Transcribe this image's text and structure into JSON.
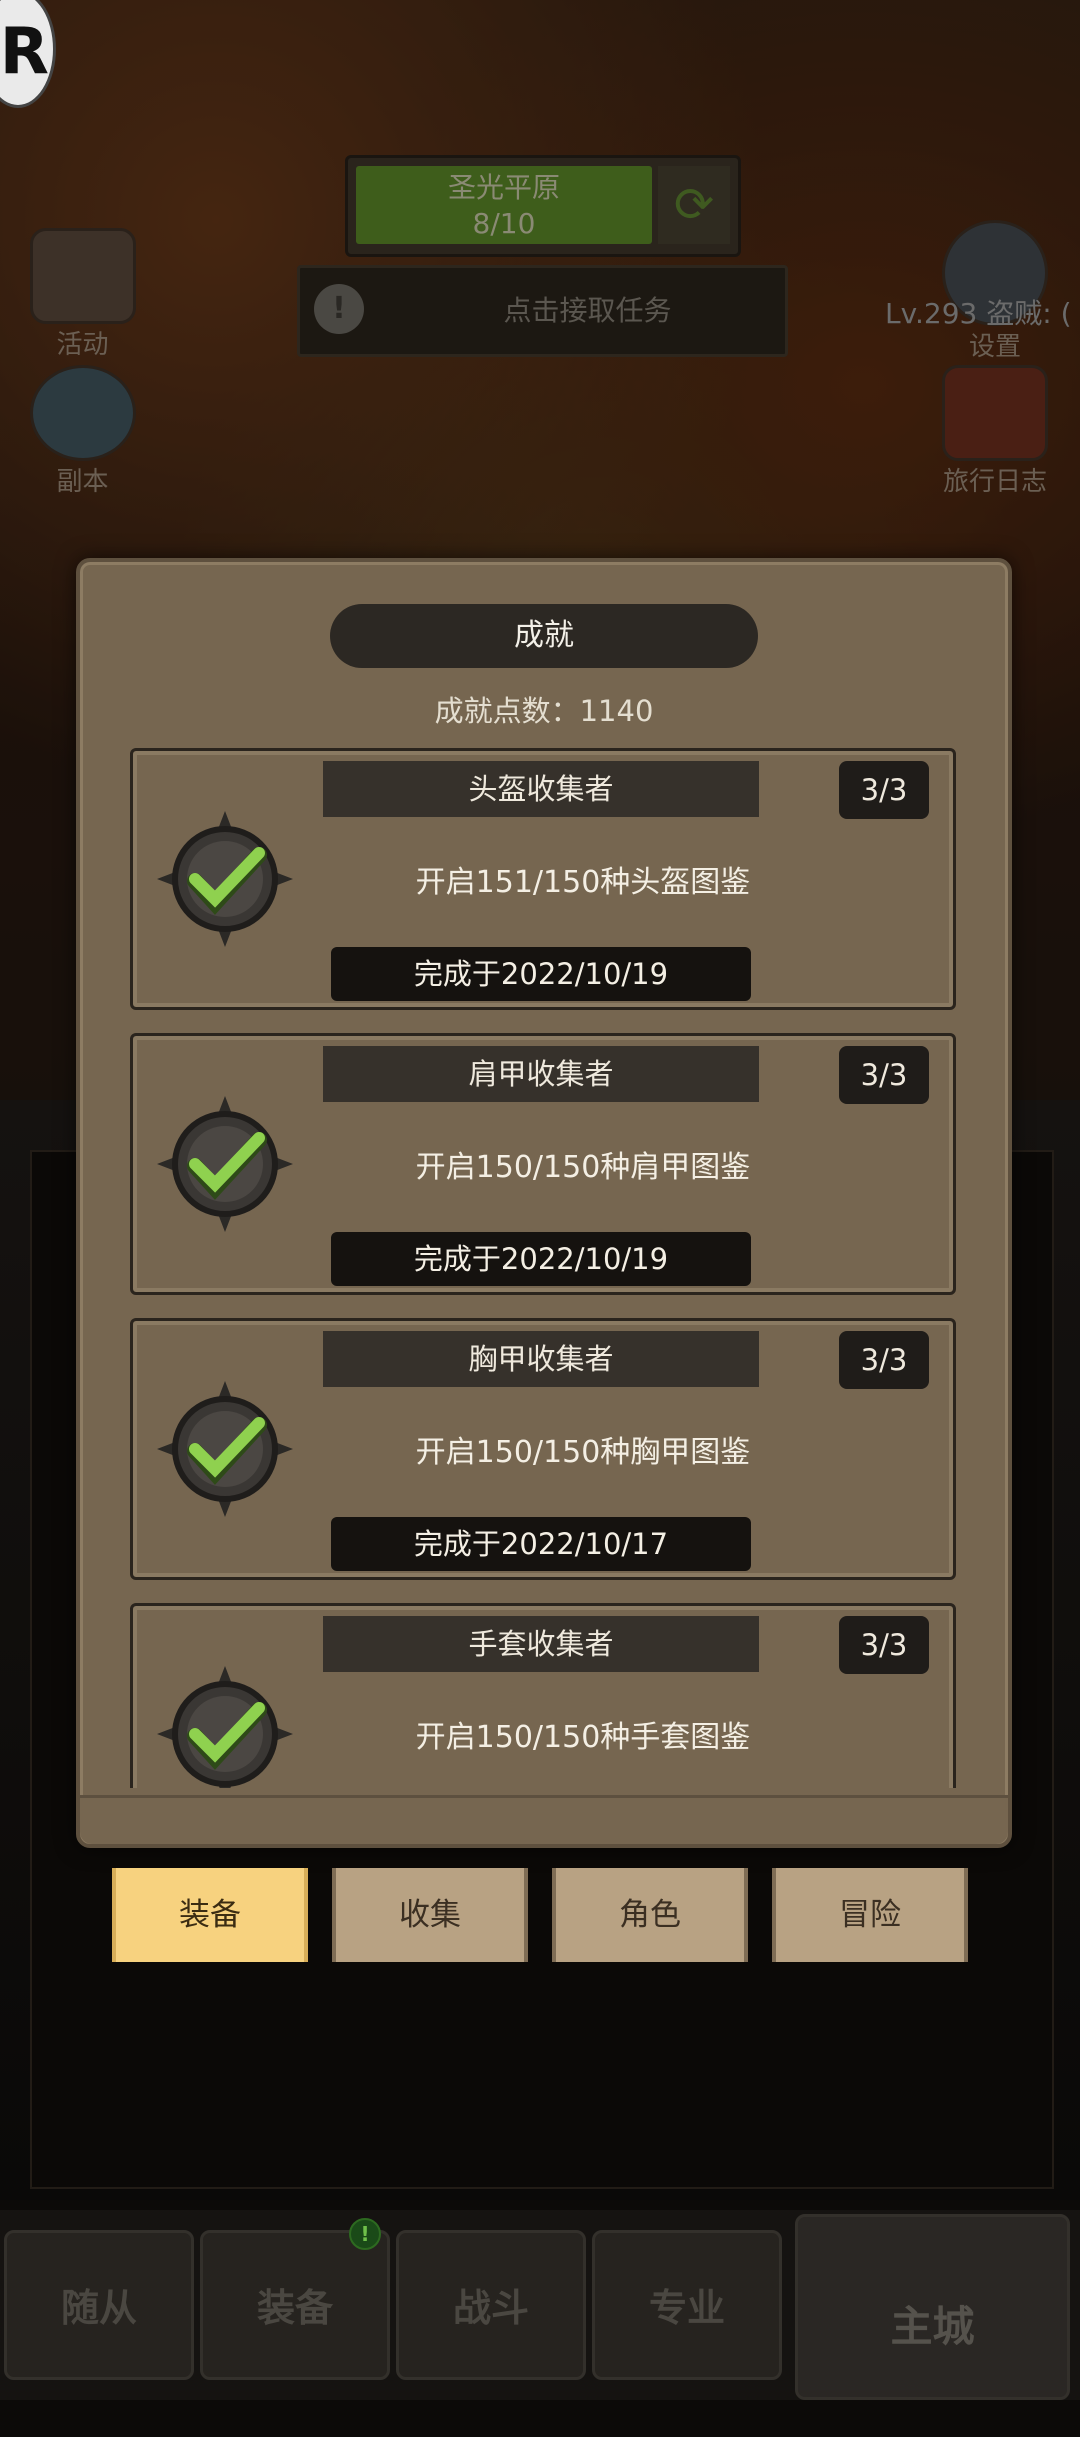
{
  "top_hud": {
    "stage_name": "圣光平原",
    "stage_progress": "8/10",
    "quest_text": "点击接取任务",
    "player_level": "Lv.293 盗贼: (",
    "buttons": {
      "activity": "活动",
      "dungeon": "副本",
      "settings": "设置",
      "journal": "旅行日志"
    }
  },
  "modal": {
    "title": "成就",
    "points_label": "成就点数：",
    "points_value": "1140",
    "achievements": [
      {
        "name": "头盔收集者",
        "count": "3/3",
        "desc": "开启151/150种头盔图鉴",
        "date": "完成于2022/10/19"
      },
      {
        "name": "肩甲收集者",
        "count": "3/3",
        "desc": "开启150/150种肩甲图鉴",
        "date": "完成于2022/10/19"
      },
      {
        "name": "胸甲收集者",
        "count": "3/3",
        "desc": "开启150/150种胸甲图鉴",
        "date": "完成于2022/10/17"
      },
      {
        "name": "手套收集者",
        "count": "3/3",
        "desc": "开启150/150种手套图鉴",
        "date": ""
      }
    ]
  },
  "sub_tabs": [
    "装备",
    "收集",
    "角色",
    "冒险"
  ],
  "active_sub_tab": 0,
  "bottom_nav": [
    "随从",
    "装备",
    "战斗",
    "专业",
    "主城"
  ],
  "nav_badge": "!",
  "colors": {
    "accent_tab": "#f7d27f",
    "check_green": "#8fd14f",
    "panel": "#766650"
  }
}
